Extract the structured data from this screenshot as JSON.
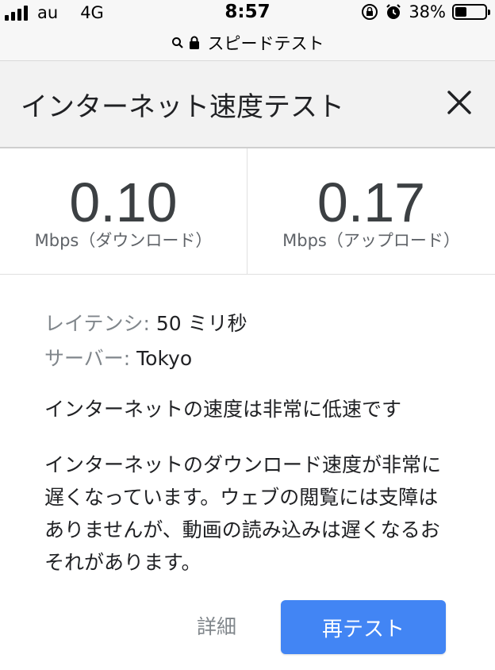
{
  "status_bar": {
    "carrier": "au",
    "network": "4G",
    "time": "8:57",
    "battery_percent": "38%",
    "battery_level": 0.38
  },
  "url_bar": {
    "text": "スピードテスト"
  },
  "dialog": {
    "title": "インターネット速度テスト",
    "close_label": "×"
  },
  "results": {
    "download": {
      "value": "0.10",
      "unit": "Mbps（ダウンロード）"
    },
    "upload": {
      "value": "0.17",
      "unit": "Mbps（アップロード）"
    }
  },
  "details": {
    "latency_label": "レイテンシ:",
    "latency_value": "50 ミリ秒",
    "server_label": "サーバー:",
    "server_value": "Tokyo"
  },
  "summary": "インターネットの速度は非常に低速です",
  "description": "インターネットのダウンロード速度が非常に遅くなっています。ウェブの閲覧には支障はありませんが、動画の読み込みは遅くなるおそれがあります。",
  "buttons": {
    "details": "詳細",
    "retest": "再テスト"
  },
  "colors": {
    "accent": "#4285f4",
    "label_gray": "#80868b"
  }
}
